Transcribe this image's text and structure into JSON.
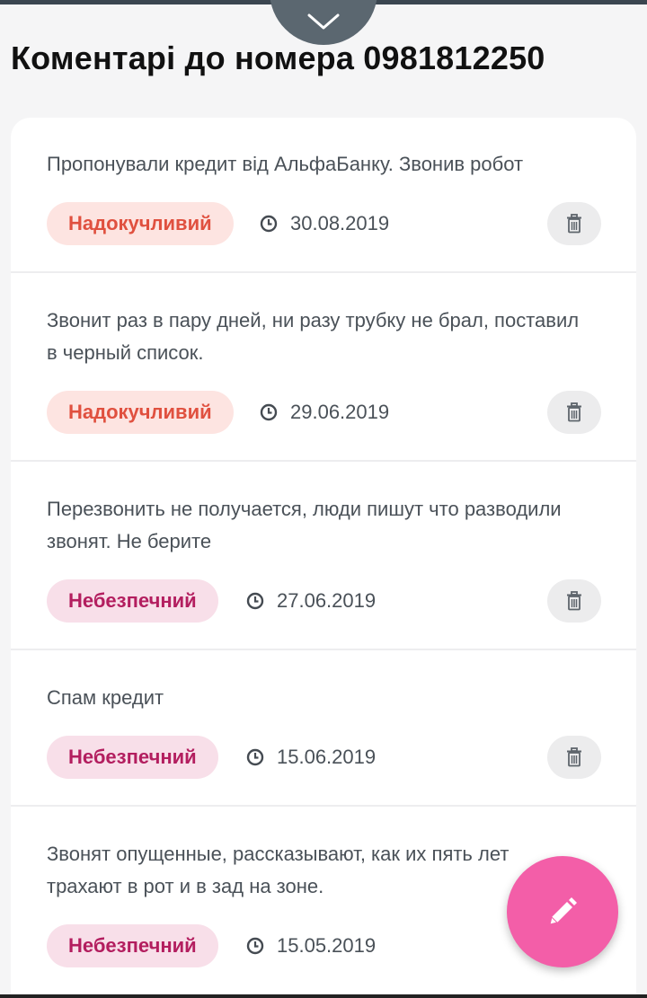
{
  "header": {
    "title": "Коментарі до номера 0981812250",
    "collapse_icon": "chevron-down-icon"
  },
  "comments": [
    {
      "text": "Пропонували кредит від АльфаБанку. Звонив робот",
      "tag": "Надокучливий",
      "tag_kind": "annoying",
      "date": "30.08.2019"
    },
    {
      "text": "Звонит раз в пару дней, ни разу трубку не брал, поставил в черный список.",
      "tag": "Надокучливий",
      "tag_kind": "annoying",
      "date": "29.06.2019"
    },
    {
      "text": "Перезвонить не получается, люди пишут что разводили звонят. Не берите",
      "tag": "Небезпечний",
      "tag_kind": "dangerous",
      "date": "27.06.2019"
    },
    {
      "text": "Спам кредит",
      "tag": "Небезпечний",
      "tag_kind": "dangerous",
      "date": "15.06.2019"
    },
    {
      "text": "Звонят опущенные, рассказывают, как их пять лет трахают в рот и в зад на зоне.",
      "tag": "Небезпечний",
      "tag_kind": "dangerous",
      "date": "15.05.2019"
    }
  ],
  "icons": {
    "date": "clock-icon",
    "delete": "trash-icon",
    "fab": "pencil-icon"
  },
  "colors": {
    "annoying_bg": "#fde4e1",
    "annoying_text": "#e0503f",
    "dangerous_bg": "#f8dfe9",
    "dangerous_text": "#b31e5f",
    "fab": "#f35ea8"
  }
}
